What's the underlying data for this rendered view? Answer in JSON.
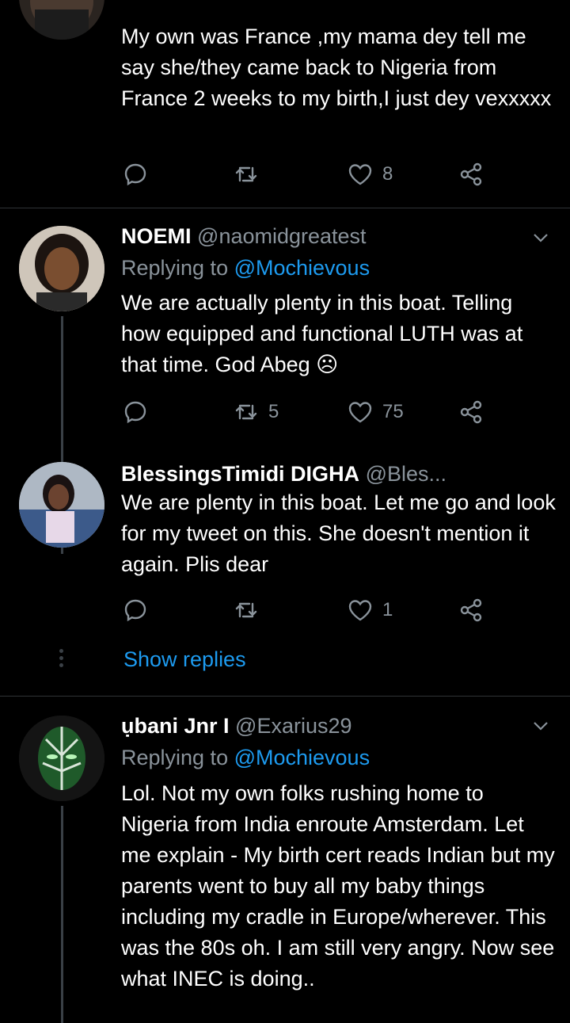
{
  "tweets": [
    {
      "body": "My own was France ,my mama dey tell me say she/they came back to Nigeria from France 2 weeks to my birth,I just dey vexxxxx",
      "actions": {
        "reply": "",
        "retweet": "",
        "like": "8"
      }
    },
    {
      "name": "NOEMI",
      "handle": "@naomidgreatest",
      "replying_prefix": "Replying to ",
      "replying_to": "@Mochievous",
      "body": "We are actually plenty in this boat. Telling how equipped and functional LUTH was at that time. God Abeg ☹",
      "actions": {
        "reply": "",
        "retweet": "5",
        "like": "75"
      }
    },
    {
      "name": "BlessingsTimidi DIGHA",
      "handle": "@Bles...",
      "body": "We are plenty in this boat. Let me go and look for my tweet on this. She doesn't mention it again. Plis dear",
      "actions": {
        "reply": "",
        "retweet": "",
        "like": "1"
      },
      "show_replies": "Show replies"
    },
    {
      "name": "ụbani Jnr I",
      "handle": "@Exarius29",
      "replying_prefix": "Replying to ",
      "replying_to": "@Mochievous",
      "body": "Lol. Not my own folks rushing home to Nigeria from India enroute Amsterdam. Let me explain - My birth cert reads Indian but my parents went to buy all my baby things including my cradle in Europe/wherever. This was the 80s oh. I am still very angry. Now see what INEC is doing.."
    }
  ],
  "icons": {
    "reply": "reply-icon",
    "retweet": "retweet-icon",
    "like": "heart-icon",
    "share": "share-icon",
    "more": "chevron-down-icon"
  },
  "colors": {
    "background": "#000000",
    "text": "#ffffff",
    "muted": "#8a939b",
    "link": "#1d9bf0",
    "divider": "#2f3336"
  }
}
